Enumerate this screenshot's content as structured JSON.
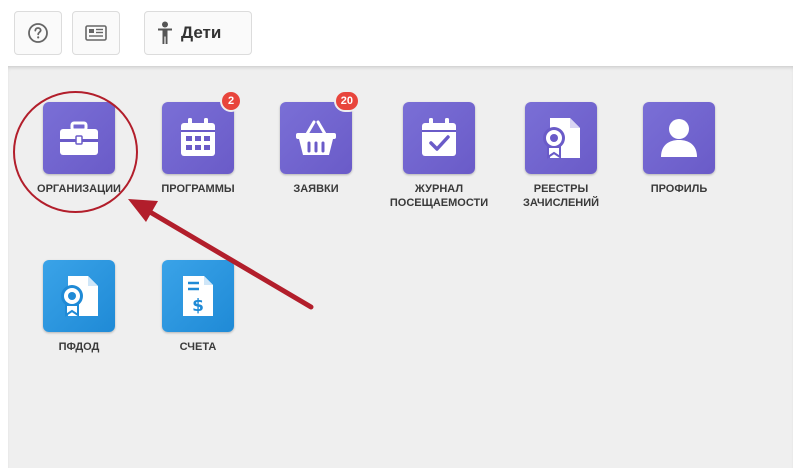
{
  "toolbar": {
    "kids_label": "Дети"
  },
  "tiles": [
    {
      "label": "ОРГАНИЗАЦИИ",
      "icon": "briefcase-icon",
      "color": "purple"
    },
    {
      "label": "ПРОГРАММЫ",
      "icon": "calendar-icon",
      "color": "purple",
      "badge": "2"
    },
    {
      "label": "ЗАЯВКИ",
      "icon": "basket-icon",
      "color": "purple",
      "badge": "20"
    },
    {
      "label": "ЖУРНАЛ ПОСЕЩАЕМОСТИ",
      "icon": "calendar-check-icon",
      "color": "purple"
    },
    {
      "label": "РЕЕСТРЫ ЗАЧИСЛЕНИЙ",
      "icon": "certificate-document-icon",
      "color": "purple"
    },
    {
      "label": "ПРОФИЛЬ",
      "icon": "user-icon",
      "color": "purple"
    },
    {
      "label": "ПФДОД",
      "icon": "certificate-document-icon",
      "color": "blue"
    },
    {
      "label": "СЧЕТА",
      "icon": "invoice-icon",
      "color": "blue"
    }
  ],
  "colors": {
    "purple": "#6a5bc8",
    "blue": "#1f8ad6",
    "badge": "#e8453c",
    "annotation": "#b21e2b"
  }
}
